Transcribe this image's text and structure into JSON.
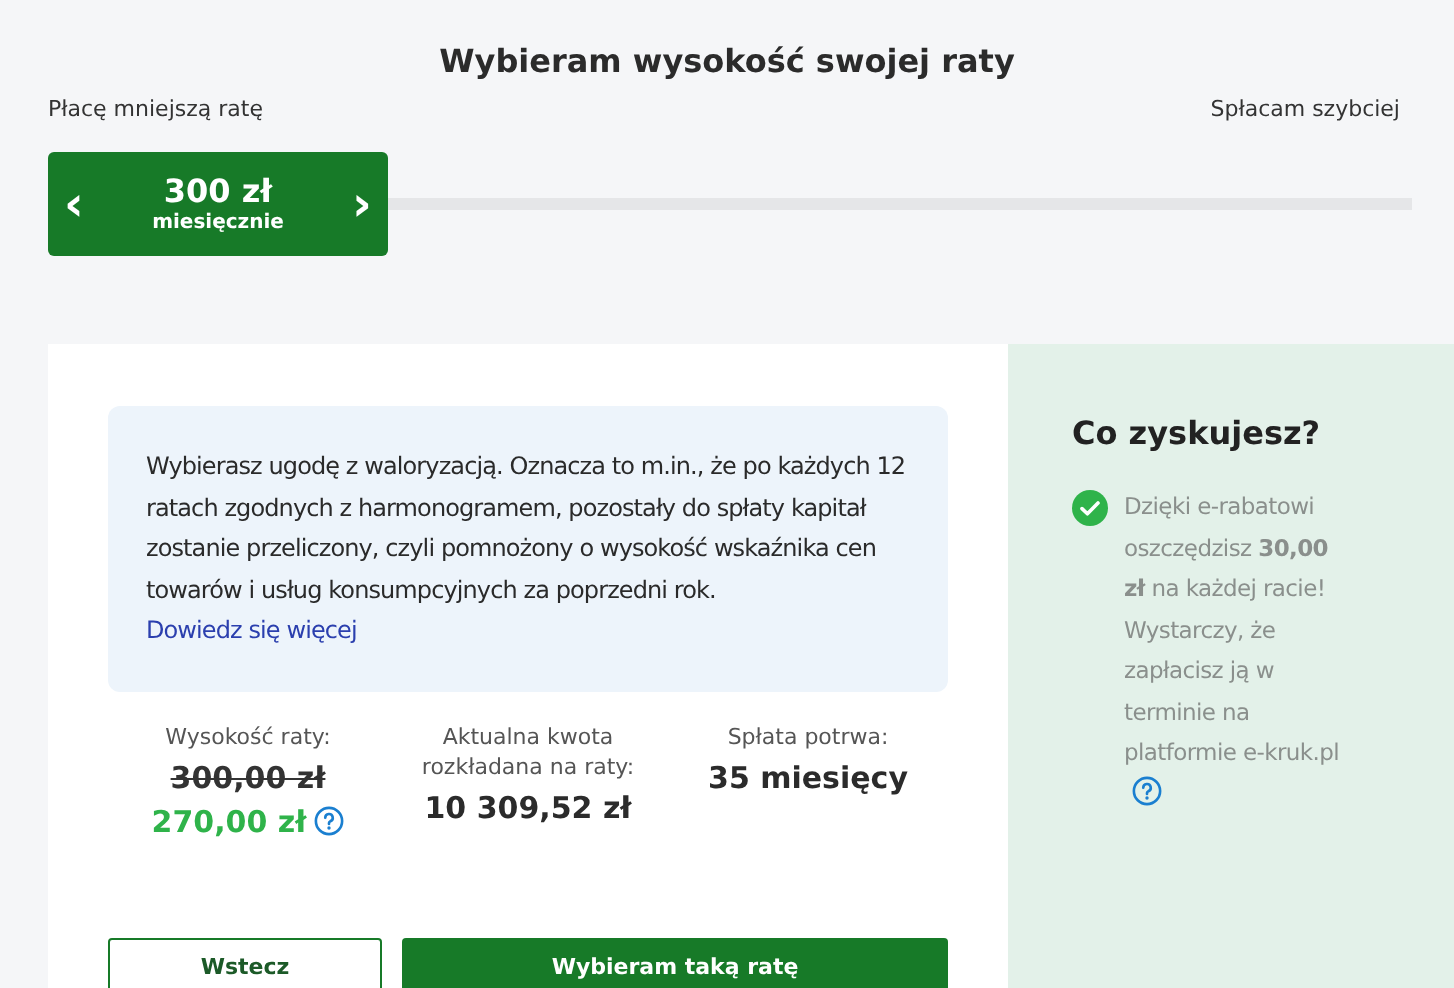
{
  "title": "Wybieram wysokość swojej raty",
  "slider": {
    "left_label": "Płacę mniejszą ratę",
    "right_label": "Spłacam szybciej",
    "amount": "300 zł",
    "unit": "miesięcznie",
    "prev": "‹",
    "next": "›",
    "level": 0
  },
  "info": {
    "text": "Wybierasz ugodę z waloryzacją. Oznacza to m.in., że po każdych 12 ratach zgodnych z harmonogramem, pozostały do spłaty kapitał zostanie przeliczony, czyli pomnożony o wysokość wskaźnika cen towarów i usług konsumpcyjnych za poprzedni rok.",
    "link": "Dowiedz się więcej"
  },
  "stats": [
    {
      "label": "Wysokość raty:",
      "old_value": "300,00 zł",
      "value": "270,00 zł",
      "help": true
    },
    {
      "label": "Aktualna kwota rozkładana na raty:",
      "value": "10 309,52 zł",
      "help": false
    },
    {
      "label": "Spłata potrwa:",
      "value": "35 miesięcy",
      "help": false
    }
  ],
  "buttons": [
    {
      "label": "Wstecz",
      "kind": "secondary"
    },
    {
      "label": "Wybieram taką ratę",
      "kind": "primary"
    }
  ],
  "benefits": {
    "title": "Co zyskujesz?",
    "items": [
      {
        "text": "Dzięki e-rabatowi oszczędzisz **30,00 zł** na każdej racie! Wystarczy, że zapłacisz ją w terminie na platformie e-kruk.pl",
        "help": true
      }
    ]
  }
}
